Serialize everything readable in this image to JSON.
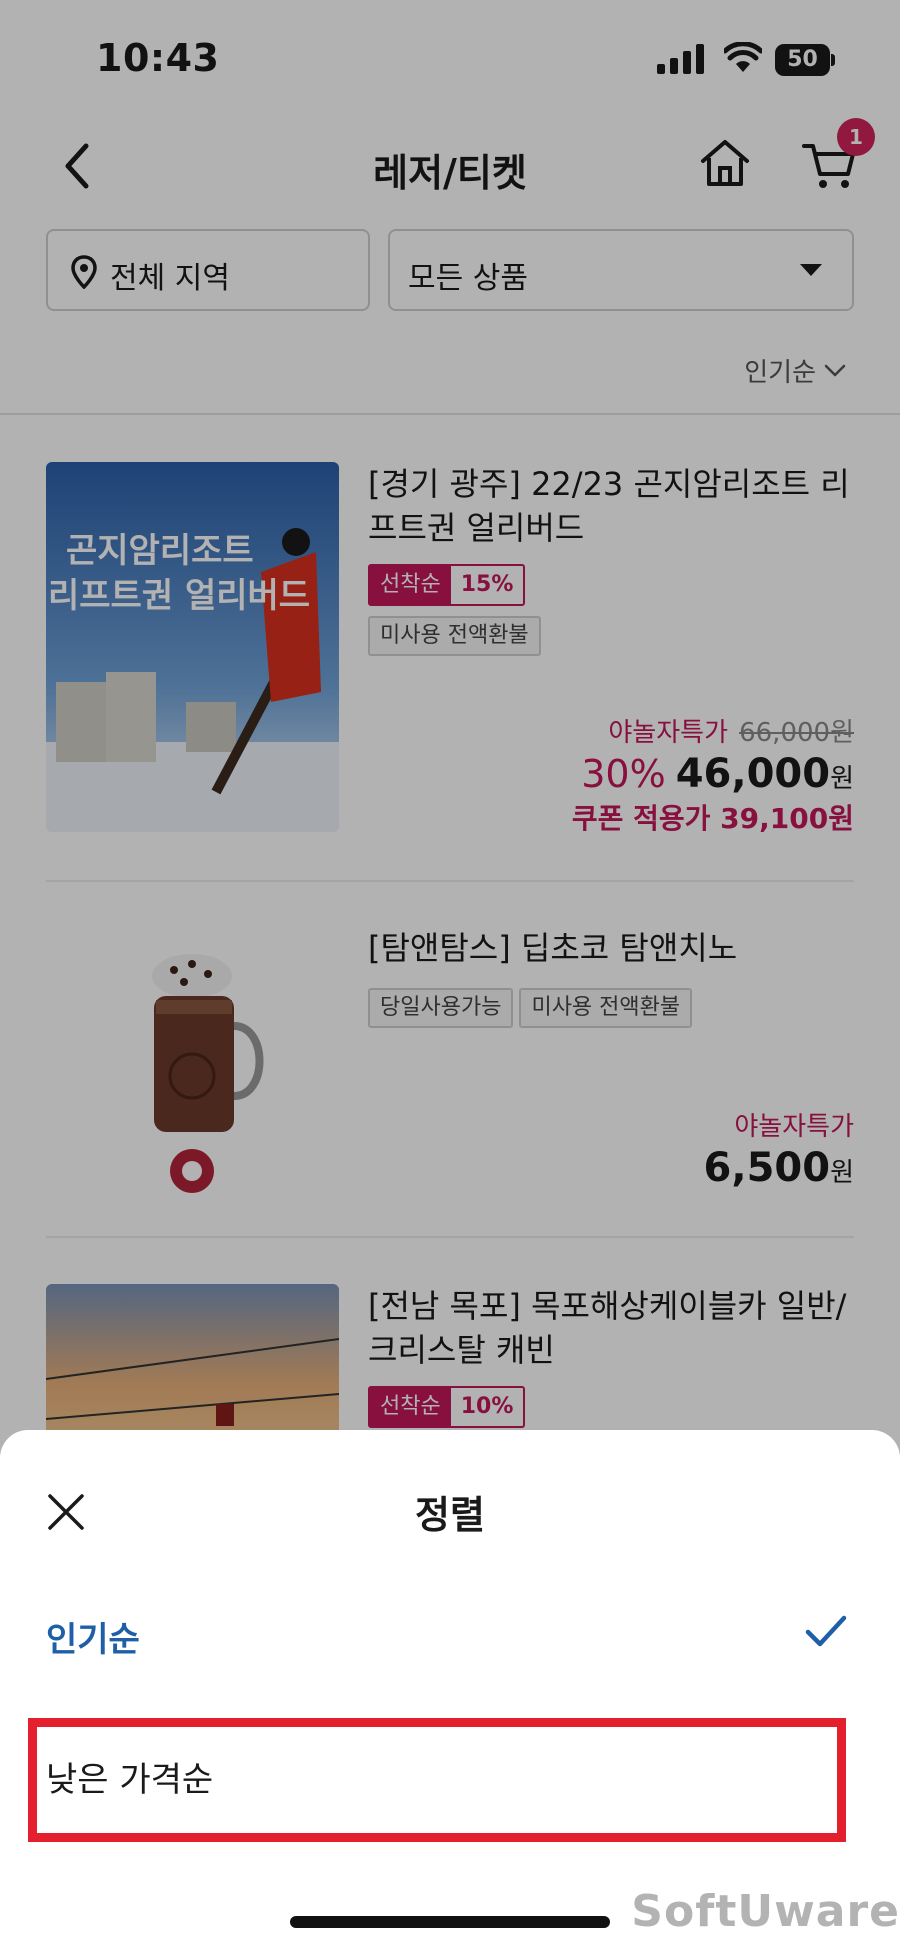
{
  "status_bar": {
    "time": "10:43",
    "battery": "50"
  },
  "header": {
    "title": "레저/티켓",
    "cart_count": "1"
  },
  "filters": {
    "region": "전체 지역",
    "category": "모든 상품"
  },
  "sort": {
    "current": "인기순"
  },
  "products": [
    {
      "title": "[경기 광주] 22/23 곤지암리조트 리프트권 얼리버드",
      "promo_label": "선착순",
      "promo_percent": "15%",
      "tags": [
        "미사용 전액환불"
      ],
      "image_text_1": "곤지암리조트",
      "image_text_2": "리프트권 얼리버드",
      "deal_label": "야놀자특가",
      "original_price": "66,000원",
      "discount": "30%",
      "price": "46,000",
      "won": "원",
      "coupon_text": "쿠폰 적용가 39,100원"
    },
    {
      "title": "[탐앤탐스] 딥초코 탐앤치노",
      "tags": [
        "당일사용가능",
        "미사용 전액환불"
      ],
      "deal_label": "야놀자특가",
      "price": "6,500",
      "won": "원"
    },
    {
      "title": "[전남 목포] 목포해상케이블카 일반/크리스탈 캐빈",
      "promo_label": "선착순",
      "promo_percent": "10%"
    }
  ],
  "sheet": {
    "title": "정렬",
    "options": [
      {
        "label": "인기순",
        "selected": true
      },
      {
        "label": "낮은 가격순",
        "selected": false
      }
    ]
  },
  "watermark": "SoftUware",
  "colors": {
    "accent": "#c2185b",
    "selected": "#1f5fa8",
    "highlight": "#e5202e"
  }
}
